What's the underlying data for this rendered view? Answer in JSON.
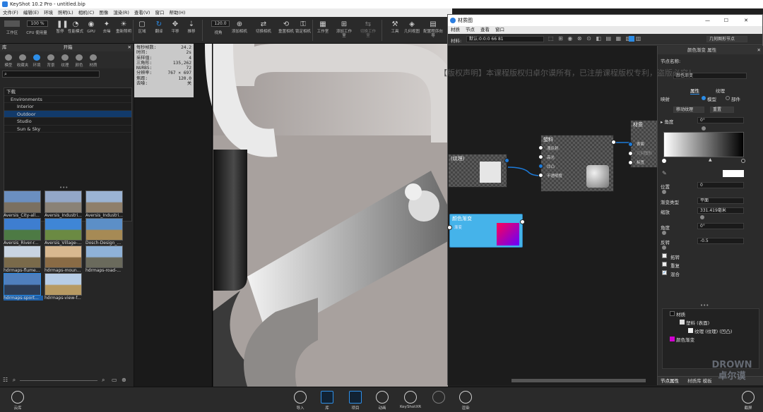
{
  "app": {
    "title": "KeyShot 10.2 Pro - untitled.bip"
  },
  "menu": [
    "文件(F)",
    "编辑(E)",
    "环境",
    "照明(L)",
    "相机(C)",
    "图像",
    "渲染(R)",
    "查看(V)",
    "窗口",
    "帮助(H)"
  ],
  "toolbar": {
    "fields": [
      "",
      "100 %"
    ],
    "items": [
      "工作区",
      "CPU 使用量",
      "暂停",
      "性能模式",
      "GPU",
      "去噪",
      "重新照明",
      "区域",
      "翻译",
      "平移",
      "推移",
      "视角",
      "添加相机",
      "切换相机",
      "重置相机",
      "锁定相机",
      "工作室",
      "添加工作室",
      "切换工作室",
      "工具",
      "几何视图",
      "配置程序向导"
    ],
    "fov_value": "120.0"
  },
  "library": {
    "header_left": "库",
    "header_right": "开箱",
    "tabs": [
      "模型",
      "收藏夹",
      "环境",
      "背景",
      "纹理",
      "颜色",
      "材质"
    ],
    "active_tab": "环境",
    "tree": [
      {
        "label": "下载",
        "indent": 0,
        "selected": false
      },
      {
        "label": "Environments",
        "indent": 1,
        "selected": false
      },
      {
        "label": "Interior",
        "indent": 2,
        "selected": false
      },
      {
        "label": "Outdoor",
        "indent": 2,
        "selected": true
      },
      {
        "label": "Studio",
        "indent": 2,
        "selected": false
      },
      {
        "label": "Sun & Sky",
        "indent": 2,
        "selected": false
      }
    ],
    "thumbnails": [
      {
        "label": "Aversis_City-all...",
        "colors": [
          "#6b8fc0",
          "#7b7060"
        ]
      },
      {
        "label": "Aversis_Industri...",
        "colors": [
          "#93a7c7",
          "#8a8276"
        ]
      },
      {
        "label": "Aversis_Industri...",
        "colors": [
          "#9bb3d3",
          "#8f7f6a"
        ]
      },
      {
        "label": "Aversis_River-r...",
        "colors": [
          "#3e7ed0",
          "#4d7a44"
        ]
      },
      {
        "label": "Aversis_Village-...",
        "colors": [
          "#3f86d6",
          "#6b8a43"
        ]
      },
      {
        "label": "Dosch-Design_...",
        "colors": [
          "#5c8fc7",
          "#a68a55"
        ]
      },
      {
        "label": "hdrmaps-flume...",
        "colors": [
          "#c9d4e2",
          "#7a6a4a"
        ]
      },
      {
        "label": "hdrmaps-moun...",
        "colors": [
          "#d8b890",
          "#8a6b45"
        ]
      },
      {
        "label": "hdrmaps-road-...",
        "colors": [
          "#8fb2d8",
          "#6a6a5c"
        ]
      },
      {
        "label": "hdrmaps-sport...",
        "colors": [
          "#4f7fbd",
          "#2c3c55"
        ]
      },
      {
        "label": "hdrmaps-view-f...",
        "colors": [
          "#b7cde6",
          "#b79a62"
        ]
      }
    ]
  },
  "stats": [
    [
      "每秒帧数:",
      "24.2"
    ],
    [
      "时间:",
      "2s"
    ],
    [
      "采样值:",
      "4"
    ],
    [
      "三角形:",
      "135,262"
    ],
    [
      "NURBS:",
      "72"
    ],
    [
      "分辨率:",
      "767 × 697"
    ],
    [
      "焦距:",
      "120.0"
    ],
    [
      "去噪:",
      "关"
    ]
  ],
  "overlay_notice": "【版权声明】本课程版权归卓尔谟所有，已注册课程版权专利，盗版必究！",
  "graph_window": {
    "title": "材质图",
    "menu": [
      "材质",
      "节点",
      "查看",
      "窗口"
    ],
    "material_label": "材料:",
    "material_value": "默认:0:0:0 66 81",
    "geometry_button": "几何图形节点",
    "nodes": {
      "texture": {
        "title": "(纹理)"
      },
      "material": {
        "title": "塑料",
        "ports": [
          "漫反射",
          "高光",
          "凹凸",
          "不透明度"
        ]
      },
      "output": {
        "title": "材质",
        "ports": [
          "表面",
          "几何图形",
          "标签"
        ]
      },
      "gradient": {
        "title": "颜色渐变",
        "subtitle": "渐变"
      }
    },
    "properties": {
      "header": "颜色渐变 属性",
      "node_name_label": "节点名称:",
      "node_name_value": "颜色渐变",
      "tabs": [
        "属性",
        "纹理"
      ],
      "mapping_label": "映射",
      "mapping_options": [
        "模型",
        "部件"
      ],
      "move_texture_button": "移动纹理",
      "reset_button": "重置",
      "angle_section": "角度",
      "angle_value": "0°",
      "position_label": "位置",
      "position_value": "0",
      "gradient_type_label": "渐变类型",
      "gradient_type_value": "平面",
      "scale_label": "缩放",
      "scale_value": "331.419毫米",
      "angle_label": "角度",
      "angle_value2": "0°",
      "offset_label": "反转",
      "offset_value": "-0.5",
      "checkboxes": [
        {
          "label": "拓转",
          "checked": false
        },
        {
          "label": "重复",
          "checked": false
        },
        {
          "label": "混合",
          "checked": true
        }
      ],
      "tree": [
        {
          "label": "材质",
          "color": "#111111"
        },
        {
          "label": "塑料 (表面)",
          "color": "#dddddd"
        },
        {
          "label": "纹理 (纹理) (凹凸)",
          "color": "#eeeeee"
        },
        {
          "label": "颜色渐变",
          "color": "#d100d1"
        }
      ],
      "bottom_tabs": [
        "节点属性",
        "材质库 模板"
      ]
    }
  },
  "bottom_bar": {
    "cloud_label": "云库",
    "items": [
      "导入",
      "库",
      "项目",
      "动画",
      "KeyShotXR",
      "",
      "渲染"
    ],
    "selected": [
      "库",
      "项目"
    ],
    "right_label": "截屏"
  },
  "watermark": {
    "line1": "DROWN",
    "line2": "卓尔谟"
  },
  "colors": {
    "accent": "#2b8ce6",
    "gradient_node": "#45b3ea",
    "gradient_swatch_a": "#ff0055",
    "gradient_swatch_b": "#6600ff"
  }
}
